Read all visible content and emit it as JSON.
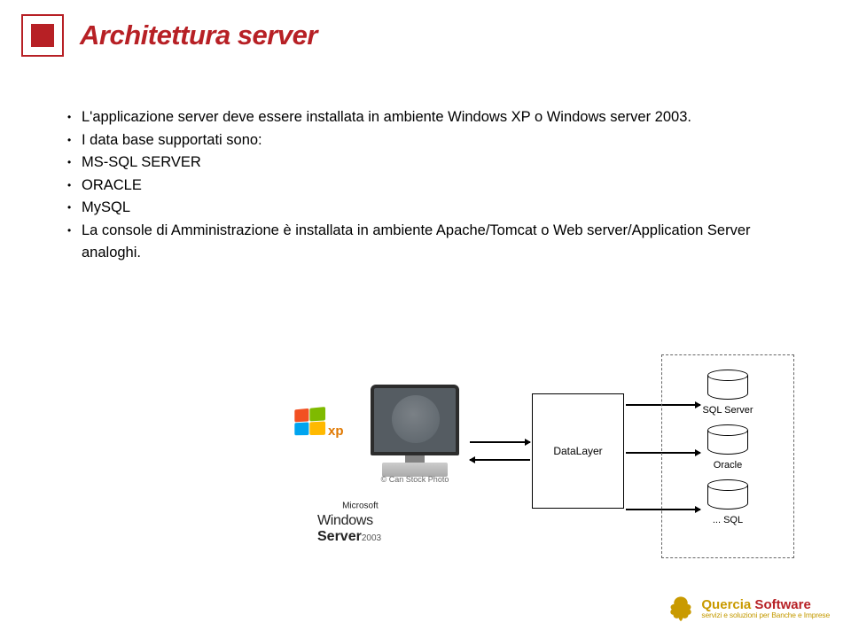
{
  "title": "Architettura server",
  "bullets": [
    "L'applicazione server deve essere installata in ambiente Windows XP o Windows server 2003.",
    "I data base supportati sono:",
    "MS-SQL SERVER",
    "ORACLE",
    "MySQL",
    "La console di Amministrazione è installata in ambiente Apache/Tomcat o Web server/Application Server analoghi."
  ],
  "diagram": {
    "xp_label": "xp",
    "monitor_label": "© Can Stock Photo",
    "win_server": {
      "ms": "Microsoft",
      "win": "Windows",
      "srv": "Server",
      "yr": "2003"
    },
    "datalayer": "DataLayer",
    "dbs": [
      "SQL Server",
      "Oracle",
      "... SQL"
    ]
  },
  "footer": {
    "brand1": "Quercia",
    "brand2": " Software",
    "tagline": "servizi e soluzioni per Banche e Imprese"
  }
}
